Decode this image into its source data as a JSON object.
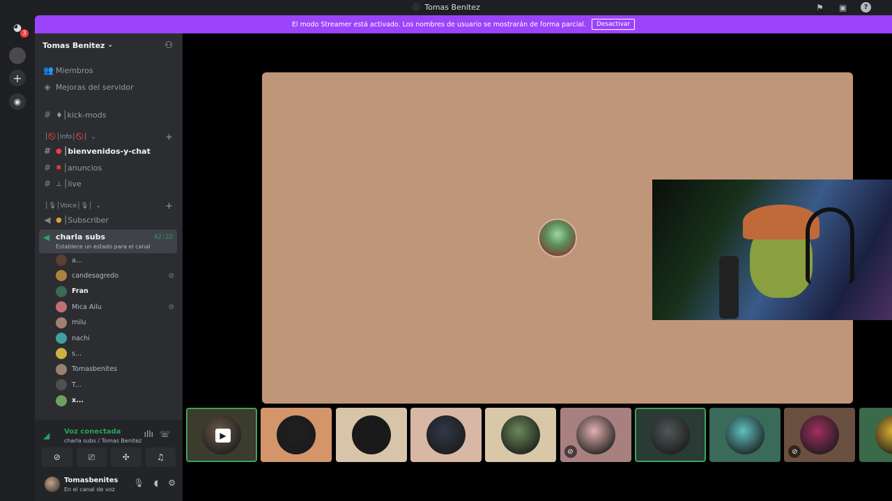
{
  "window": {
    "title": "Tomas Benitez"
  },
  "banner": {
    "text": "El modo Streamer está activado. Los nombres de usuario se mostrarán de forma parcial.",
    "button": "Desactivar",
    "color": "#9b44fb"
  },
  "server_bar": {
    "discord_badge": "3"
  },
  "server": {
    "name": "Tomas Benitez",
    "dropdown_icon": "chevron-down-icon"
  },
  "channels": {
    "members": "Miembros",
    "boosts": "Mejoras del servidor",
    "kick_mods": "♦│kick-mods",
    "cat_info": "│🚫│Info│🚫│",
    "bienvenidos": "│bienvenidos-y-chat",
    "anuncios": "│anuncios",
    "live": "│live",
    "cat_voice": "│🎙│Voice│🎙│",
    "subscriber": "│Subscriber"
  },
  "voice_channel": {
    "name": "charla subs",
    "time": "42:22",
    "status": "Establece un estado para el canal"
  },
  "voice_users": [
    {
      "name": "a...",
      "muted": false,
      "bold": false,
      "color": "#5a4030"
    },
    {
      "name": "candesagredo",
      "muted": true,
      "bold": false,
      "color": "#b08040"
    },
    {
      "name": "Fran",
      "muted": false,
      "bold": true,
      "color": "#3a6a50"
    },
    {
      "name": "Mica Ailu",
      "muted": true,
      "bold": false,
      "color": "#c07070"
    },
    {
      "name": "milu",
      "muted": false,
      "bold": false,
      "color": "#a08070"
    },
    {
      "name": "nachi",
      "muted": false,
      "bold": false,
      "color": "#40a0a0"
    },
    {
      "name": "s...",
      "muted": false,
      "bold": false,
      "color": "#d0b040"
    },
    {
      "name": "Tomasbenites",
      "muted": false,
      "bold": false,
      "color": "#9a8070"
    },
    {
      "name": "T...",
      "muted": false,
      "bold": false,
      "color": "#505050"
    },
    {
      "name": "x...",
      "muted": false,
      "bold": true,
      "color": "#70a060"
    }
  ],
  "voice_panel": {
    "status": "Voz conectada",
    "location": "charla subs / Tomas Benitez"
  },
  "user_panel": {
    "name": "Tomasbenites",
    "status": "En el canal de voz"
  },
  "tiles": [
    {
      "bg": "#3b3b2e",
      "av": "#6a5a4a",
      "selected": true,
      "muted": false,
      "camera": true
    },
    {
      "bg": "#d4956a",
      "av": "#202020",
      "selected": false,
      "muted": false,
      "camera": false
    },
    {
      "bg": "#d8c4a8",
      "av": "#1a1a1a",
      "selected": false,
      "muted": false,
      "camera": false
    },
    {
      "bg": "#d8b8a4",
      "av": "#303848",
      "selected": false,
      "muted": false,
      "camera": false
    },
    {
      "bg": "#d8c8a8",
      "av": "#6a8a5a",
      "selected": false,
      "muted": false,
      "camera": false
    },
    {
      "bg": "#a88080",
      "av": "#e0b0b0",
      "selected": false,
      "muted": true,
      "camera": false
    },
    {
      "bg": "#2a3a34",
      "av": "#505858",
      "selected": true,
      "muted": false,
      "camera": false
    },
    {
      "bg": "#3a6a5a",
      "av": "#60c0c0",
      "selected": false,
      "muted": false,
      "camera": false
    },
    {
      "bg": "#6a5040",
      "av": "#a03060",
      "selected": false,
      "muted": true,
      "camera": false
    },
    {
      "bg": "#3a6a4a",
      "av": "#e0b030",
      "selected": false,
      "muted": false,
      "camera": false
    }
  ]
}
